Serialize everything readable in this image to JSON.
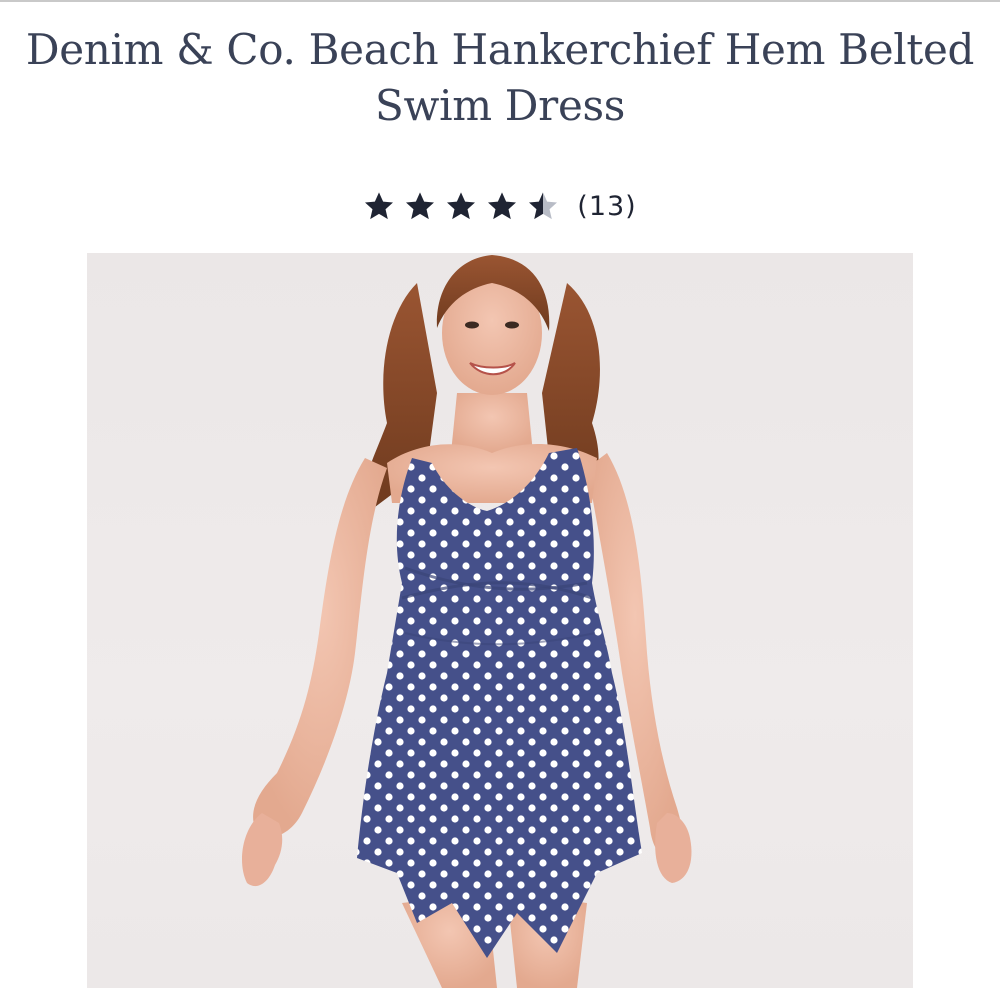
{
  "product": {
    "title": "Denim & Co. Beach Hankerchief Hem Belted Swim Dress",
    "rating": {
      "stars": 4.5,
      "max": 5,
      "count_label": "(13)",
      "filled_color": "#1f2433",
      "empty_color": "#b8bcc6"
    },
    "image": {
      "alt_description": "Model wearing navy polka-dot swim dress",
      "dress_color": "#45508a",
      "dot_color": "#ffffff"
    }
  }
}
